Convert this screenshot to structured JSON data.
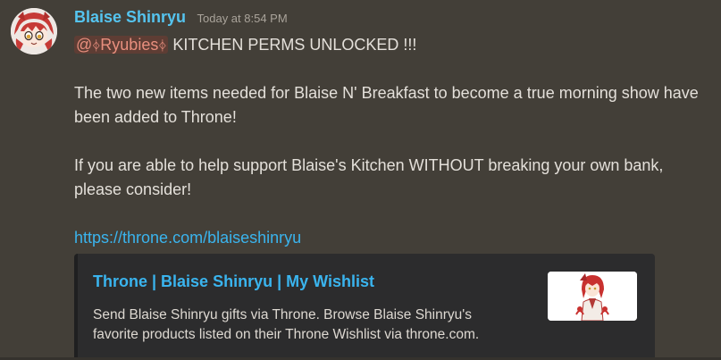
{
  "message": {
    "author": "Blaise Shinryu",
    "timestamp": "Today at 8:54 PM",
    "mention_prefix": "@",
    "mention_name": "Ryubies",
    "mention_rune": "ᛄ",
    "headline": "KITCHEN PERMS UNLOCKED !!!",
    "paragraph1_line1": "The two new items needed for Blaise N' Breakfast to become a true morning show have",
    "paragraph1_line2": "been added to Throne!",
    "paragraph2_line1": "If you are able to help support Blaise's Kitchen WITHOUT breaking your own bank,",
    "paragraph2_line2": "please consider!",
    "link": "https://throne.com/blaiseshinryu"
  },
  "embed": {
    "title": "Throne | Blaise Shinryu | My Wishlist",
    "description_line1": "Send Blaise Shinryu gifts via Throne. Browse Blaise Shinryu's",
    "description_line2": "favorite products listed on their Throne Wishlist via throne.com."
  },
  "colors": {
    "background": "#433f38",
    "username": "#55c4ef",
    "link": "#3ab4ee",
    "mention_bg": "#5e3d34",
    "mention_text": "#e88f7e",
    "embed_bg": "#2c2c2d"
  },
  "icons": {
    "avatar": "anime-avatar-red-hair",
    "thumbnail": "character-thumbnail"
  }
}
